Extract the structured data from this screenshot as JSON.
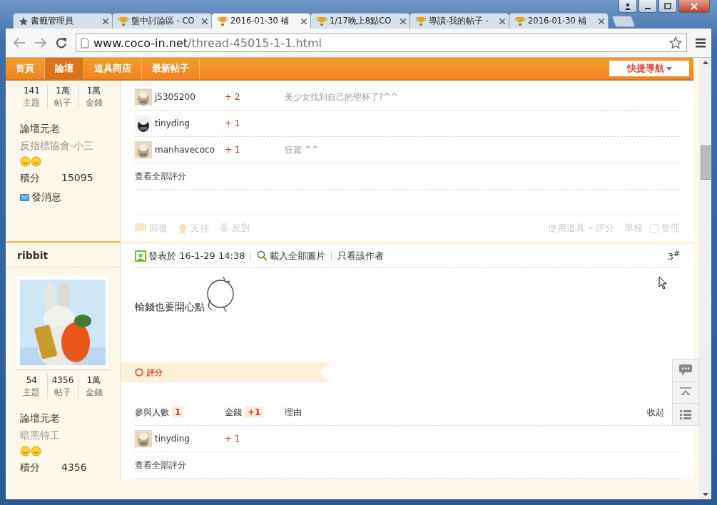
{
  "browser": {
    "tabs": [
      {
        "title": "書籤管理員",
        "kind": "star",
        "selected": false
      },
      {
        "title": "盤中討論區 - CO",
        "kind": "trophy",
        "selected": false
      },
      {
        "title": "2016-01-30 補",
        "kind": "trophy",
        "selected": true
      },
      {
        "title": "1/17晚上8點CO",
        "kind": "trophy",
        "selected": false
      },
      {
        "title": "導讀-我的帖子 -",
        "kind": "trophy",
        "selected": false
      },
      {
        "title": "2016-01-30 補",
        "kind": "trophy",
        "selected": false
      }
    ],
    "url_host": "www.coco-in.net",
    "url_path": "/thread-45015-1-1.html"
  },
  "nav": {
    "items": [
      {
        "label": "首頁",
        "selected": false
      },
      {
        "label": "論壇",
        "selected": true
      },
      {
        "label": "道具商店",
        "selected": false
      },
      {
        "label": "最新帖子",
        "selected": false
      }
    ],
    "quick_nav": "快捷導航"
  },
  "posts": [
    {
      "stats": [
        {
          "value": "141",
          "label": "主題"
        },
        {
          "value": "1萬",
          "label": "帖子"
        },
        {
          "value": "1萬",
          "label": "金錢"
        }
      ],
      "rank": "論壇元老",
      "custom_title": "反指標協會-小三",
      "points_label": "積分",
      "points": "15095",
      "message": "發消息",
      "rating": {
        "rows": [
          {
            "user": "j5305200",
            "money": "+ 2",
            "reason": "美少女找到自己的聖杯了?^^"
          },
          {
            "user": "tinyding",
            "money": "+ 1"
          },
          {
            "user": "manhavecoco",
            "money": "+ 1",
            "reason": "狂賀 ^^"
          }
        ],
        "view_all": "查看全部評分"
      },
      "actions": {
        "reply": "回復",
        "support": "支持",
        "oppose": "反對",
        "tools": "使用道具",
        "rate": "評分",
        "report": "舉報",
        "manage": "管理",
        "manage_checked": false
      }
    },
    {
      "author": "ribbit",
      "stats": [
        {
          "value": "54",
          "label": "主題"
        },
        {
          "value": "4356",
          "label": "帖子"
        },
        {
          "value": "1萬",
          "label": "金錢"
        }
      ],
      "rank": "論壇元老",
      "custom_title": "暗黑特工",
      "points_label": "積分",
      "points": "4356",
      "header": {
        "posted": "發表於 16-1-29 14:38",
        "load_images": "載入全部圖片",
        "author_only": "只看該作者",
        "floor": "3$^{#}$"
      },
      "body": "輸錢也要開心點",
      "rating_banner": "評分",
      "rating": {
        "participants_label": "參與人數",
        "participants": "1",
        "money_label": "金錢",
        "money": "+1",
        "reason_label": "理由",
        "collapse": "收起",
        "rows": [
          {
            "user": "tinyding",
            "money": "+ 1"
          }
        ],
        "view_all": "查看全部評分"
      }
    }
  ]
}
